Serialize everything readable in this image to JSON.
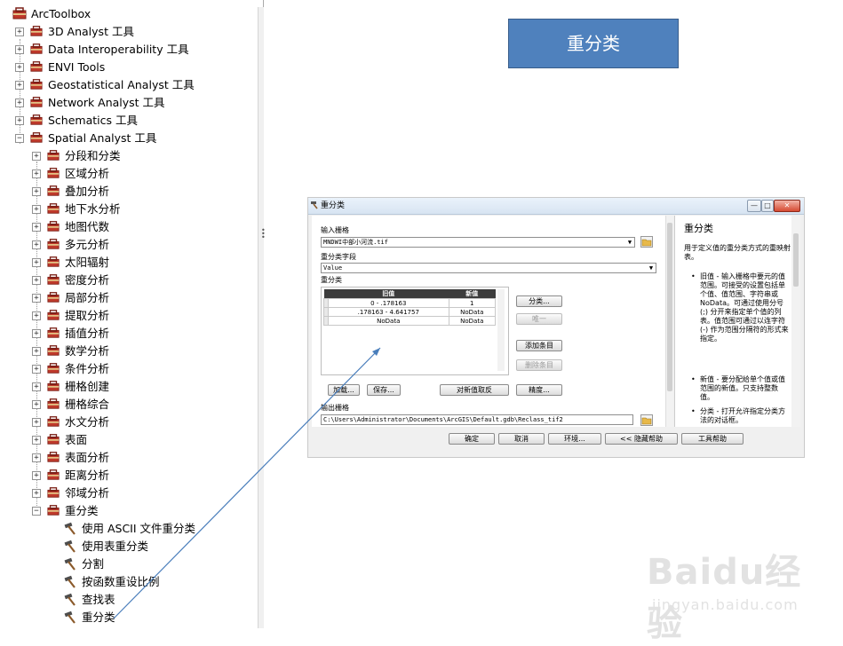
{
  "toolbox": {
    "root_label": "ArcToolbox",
    "toolsets": [
      {
        "label": "3D Analyst 工具",
        "expander": "+"
      },
      {
        "label": "Data Interoperability 工具",
        "expander": "+"
      },
      {
        "label": "ENVI Tools",
        "expander": "+"
      },
      {
        "label": "Geostatistical Analyst 工具",
        "expander": "+"
      },
      {
        "label": "Network Analyst 工具",
        "expander": "+"
      },
      {
        "label": "Schematics 工具",
        "expander": "+"
      },
      {
        "label": "Spatial Analyst 工具",
        "expander": "−"
      }
    ],
    "spatial_children": [
      {
        "label": "分段和分类",
        "expander": "+"
      },
      {
        "label": "区域分析",
        "expander": "+"
      },
      {
        "label": "叠加分析",
        "expander": "+"
      },
      {
        "label": "地下水分析",
        "expander": "+"
      },
      {
        "label": "地图代数",
        "expander": "+"
      },
      {
        "label": "多元分析",
        "expander": "+"
      },
      {
        "label": "太阳辐射",
        "expander": "+"
      },
      {
        "label": "密度分析",
        "expander": "+"
      },
      {
        "label": "局部分析",
        "expander": "+"
      },
      {
        "label": "提取分析",
        "expander": "+"
      },
      {
        "label": "插值分析",
        "expander": "+"
      },
      {
        "label": "数学分析",
        "expander": "+"
      },
      {
        "label": "条件分析",
        "expander": "+"
      },
      {
        "label": "栅格创建",
        "expander": "+"
      },
      {
        "label": "栅格综合",
        "expander": "+"
      },
      {
        "label": "水文分析",
        "expander": "+"
      },
      {
        "label": "表面",
        "expander": "+"
      },
      {
        "label": "表面分析",
        "expander": "+"
      },
      {
        "label": "距离分析",
        "expander": "+"
      },
      {
        "label": "邻域分析",
        "expander": "+"
      },
      {
        "label": "重分类",
        "expander": "−"
      }
    ],
    "reclass_tools": [
      {
        "label": "使用 ASCII 文件重分类"
      },
      {
        "label": "使用表重分类"
      },
      {
        "label": "分割"
      },
      {
        "label": "按函数重设比例"
      },
      {
        "label": "查找表"
      },
      {
        "label": "重分类"
      }
    ]
  },
  "title_box": {
    "text": "重分类"
  },
  "dialog": {
    "title": "重分类",
    "window_buttons": {
      "minimize": "—",
      "maximize": "□",
      "close": "✕"
    },
    "input_raster_label": "输入栅格",
    "input_raster_value": "MNDWI中部小河流.tif",
    "reclass_field_label": "重分类字段",
    "reclass_field_value": "Value",
    "reclassification_label": "重分类",
    "table": {
      "headers": [
        "旧值",
        "新值"
      ],
      "rows": [
        [
          "0 - .178163",
          "1"
        ],
        [
          ".178163 - 4.641757",
          "NoData"
        ],
        [
          "NoData",
          "NoData"
        ]
      ]
    },
    "side_buttons": {
      "classify": "分类...",
      "unique": "唯一",
      "add_entry": "添加条目",
      "delete_entry": "删除条目"
    },
    "lower_buttons": {
      "load": "加载...",
      "save": "保存...",
      "reverse": "对新值取反",
      "precision": "精度..."
    },
    "output_raster_label": "输出栅格",
    "output_raster_value": "C:\\Users\\Administrator\\Documents\\ArcGIS\\Default.gdb\\Reclass_tif2",
    "bottom_buttons": {
      "ok": "确定",
      "cancel": "取消",
      "environments": "环境...",
      "hide_help": "<< 隐藏帮助",
      "tool_help": "工具帮助"
    },
    "help": {
      "title": "重分类",
      "intro": "用于定义值的重分类方式的重映射表。",
      "bullet": "•",
      "items": [
        "旧值 - 输入栅格中要元的值范围。可接受的设置包括单个值、值范围、字符串或 NoData。可通过使用分号 (;) 分开来指定单个值的列表。值范围可通过以连字符 (-) 作为范围分隔符的形式来指定。",
        "新值 - 要分配给单个值或值范围的新值。只支持整数值。",
        "分类 - 打开允许指定分类方法的对话框。"
      ]
    }
  },
  "watermark": {
    "logo": "Baidu经验",
    "url": "jingyan.baidu.com"
  },
  "colors": {
    "title_box": "#4f81bd",
    "connector": "#4a7ebb",
    "table_header": "#3c3c3c"
  },
  "icons": [
    "toolbox-icon",
    "toolset-icon",
    "hammer-tool-icon",
    "folder-icon",
    "plus-expander-icon",
    "minus-expander-icon"
  ]
}
